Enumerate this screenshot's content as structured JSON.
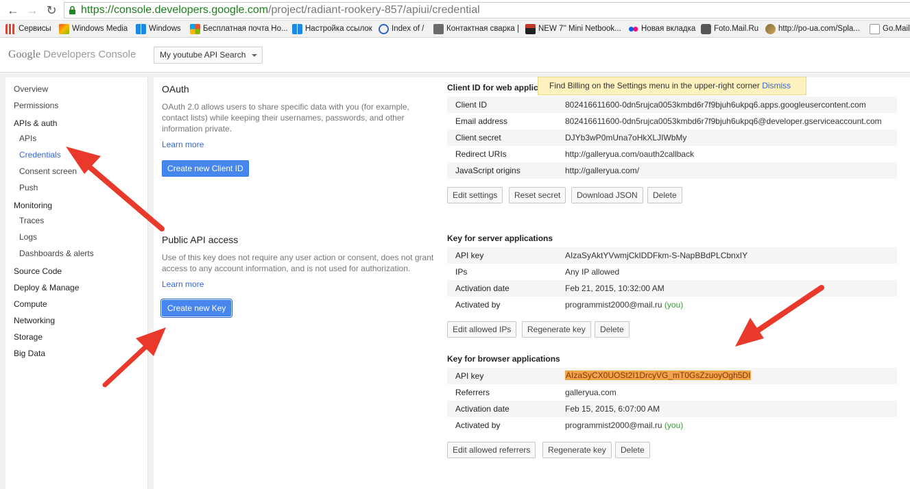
{
  "browser": {
    "url_scheme": "https://",
    "url_host": "console.developers.google.com",
    "url_path": "/project/radiant-rookery-857/apiui/credential",
    "bookmarks": [
      {
        "label": "Сервисы",
        "icon": "apps-grid-icon",
        "color": "#d34836"
      },
      {
        "label": "Windows Media",
        "icon": "windows-media-icon",
        "color": "#e8a33d"
      },
      {
        "label": "Windows",
        "icon": "windows-icon",
        "color": "#1e88e5"
      },
      {
        "label": "Бесплатная почта Ho...",
        "icon": "msn-icon",
        "color": "#f25022"
      },
      {
        "label": "Настройка ссылок",
        "icon": "windows-icon",
        "color": "#1e88e5"
      },
      {
        "label": "Index of /",
        "icon": "index-icon",
        "color": "#2a64c5"
      },
      {
        "label": "Контактная сварка |",
        "icon": "site-icon",
        "color": "#6b6b6b"
      },
      {
        "label": "NEW 7'' Mini Netbook...",
        "icon": "site-icon",
        "color": "#c0392b"
      },
      {
        "label": "Новая вкладка",
        "icon": "flickr-icon",
        "color": "#ff0084"
      },
      {
        "label": "Foto.Mail.Ru",
        "icon": "camera-icon",
        "color": "#555555"
      },
      {
        "label": "http://po-ua.com/Spla...",
        "icon": "site-icon",
        "color": "#8a6d3b"
      },
      {
        "label": "Go.Mail.",
        "icon": "page-icon",
        "color": "#999999"
      }
    ]
  },
  "header": {
    "logo_google": "Google",
    "logo_rest": "Developers Console",
    "project_selected": "My youtube API Search"
  },
  "sidebar": {
    "items": [
      {
        "label": "Overview"
      },
      {
        "label": "Permissions"
      },
      {
        "label": "APIs & auth"
      },
      {
        "label": "APIs"
      },
      {
        "label": "Credentials"
      },
      {
        "label": "Consent screen"
      },
      {
        "label": "Push"
      },
      {
        "label": "Monitoring"
      },
      {
        "label": "Traces"
      },
      {
        "label": "Logs"
      },
      {
        "label": "Dashboards & alerts"
      },
      {
        "label": "Source Code"
      },
      {
        "label": "Deploy & Manage"
      },
      {
        "label": "Compute"
      },
      {
        "label": "Networking"
      },
      {
        "label": "Storage"
      },
      {
        "label": "Big Data"
      }
    ]
  },
  "oauth": {
    "title": "OAuth",
    "desc_1": "OAuth 2.0 allows users to share specific data with you (for example,",
    "desc_2": "contact lists) while keeping their usernames, passwords, and other",
    "desc_3": "information private.",
    "learn_more": "Learn more",
    "create_button": "Create new Client ID"
  },
  "public_api": {
    "title": "Public API access",
    "desc_1": "Use of this key does not require any user action or consent, does not grant",
    "desc_2": "access to any account information, and is not used for authorization.",
    "learn_more": "Learn more",
    "create_button": "Create new Key"
  },
  "notification": {
    "text": "Find Billing on the Settings menu in the upper-right corner",
    "dismiss": "Dismiss"
  },
  "web_client": {
    "title": "Client ID for web applica",
    "rows": [
      {
        "key": "Client ID",
        "value": "802416611600-0dn5rujca0053kmbd6r7f9bjuh6ukpq6.apps.googleusercontent.com"
      },
      {
        "key": "Email address",
        "value": "802416611600-0dn5rujca0053kmbd6r7f9bjuh6ukpq6@developer.gserviceaccount.com"
      },
      {
        "key": "Client secret",
        "value": "DJYb3wP0mUna7oHkXLJIWbMy"
      },
      {
        "key": "Redirect URIs",
        "value": "http://galleryua.com/oauth2callback"
      },
      {
        "key": "JavaScript origins",
        "value": "http://galleryua.com/"
      }
    ],
    "buttons": [
      "Edit settings",
      "Reset secret",
      "Download JSON",
      "Delete"
    ]
  },
  "server_key": {
    "title": "Key for server applications",
    "rows": [
      {
        "key": "API key",
        "value": "AIzaSyAktYVwmjCkIDDFkm-S-NapBBdPLCbnxIY"
      },
      {
        "key": "IPs",
        "value": "Any IP allowed"
      },
      {
        "key": "Activation date",
        "value": "Feb 21, 2015, 10:32:00 AM"
      },
      {
        "key": "Activated by",
        "value": "programmist2000@mail.ru",
        "you": "(you)"
      }
    ],
    "buttons": [
      "Edit allowed IPs",
      "Regenerate key",
      "Delete"
    ]
  },
  "browser_key": {
    "title": "Key for browser applications",
    "rows": [
      {
        "key": "API key",
        "value": "AIzaSyCX0UOSt2I1DrcyVG_mT0GsZzuoyOgh5DI",
        "highlight_color": "#f4a34a"
      },
      {
        "key": "Referrers",
        "value": "galleryua.com"
      },
      {
        "key": "Activation date",
        "value": "Feb 15, 2015, 6:07:00 AM"
      },
      {
        "key": "Activated by",
        "value": "programmist2000@mail.ru",
        "you": "(you)"
      }
    ],
    "buttons": [
      "Edit allowed referrers",
      "Regenerate key",
      "Delete"
    ]
  },
  "colors": {
    "accent_blue": "#4787ed",
    "link_blue": "#3367d6",
    "annotation_arrow": "#e8392b",
    "notice_bg": "#fdf1be"
  }
}
